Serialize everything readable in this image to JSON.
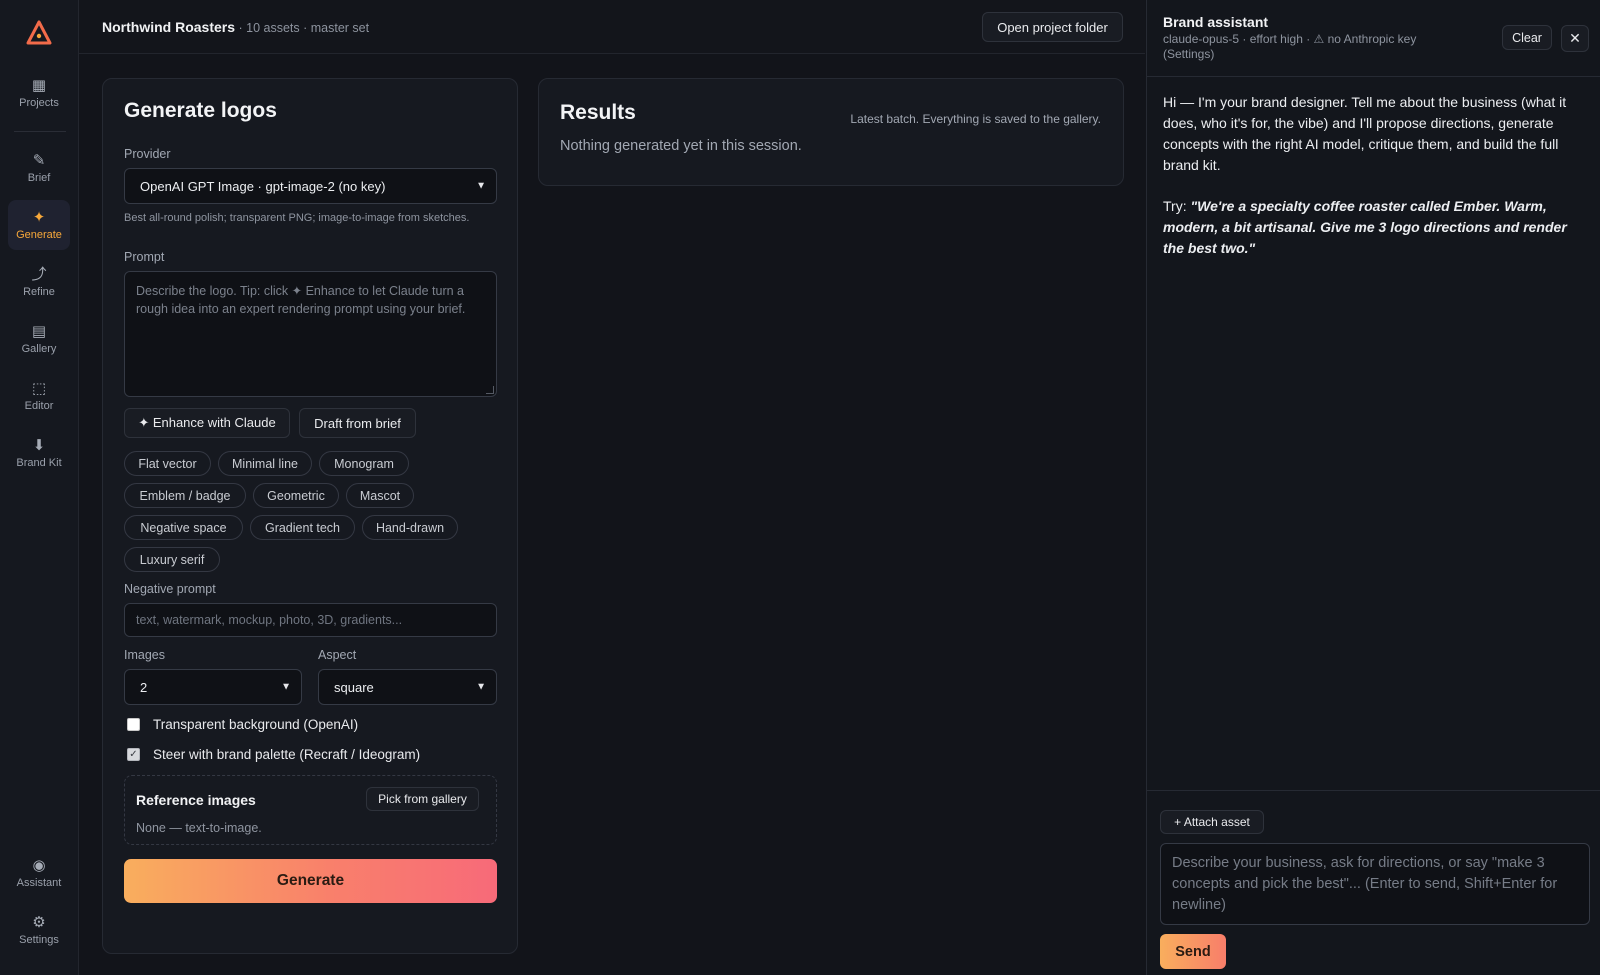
{
  "colors": {
    "accent": "#f7a83a",
    "bg": "#12141a",
    "panel": "#161920",
    "gradient_start": "#f9ae5d",
    "gradient_end": "#f76a79"
  },
  "rail": {
    "items": [
      {
        "icon": "grid-icon",
        "glyph": "▦",
        "label": "Projects"
      },
      {
        "icon": "pencil-icon",
        "glyph": "✎",
        "label": "Brief"
      },
      {
        "icon": "sparkle-icon",
        "glyph": "✦",
        "label": "Generate"
      },
      {
        "icon": "refine-arrow-icon",
        "glyph": "⤴",
        "label": "Refine"
      },
      {
        "icon": "gallery-icon",
        "glyph": "▤",
        "label": "Gallery"
      },
      {
        "icon": "editor-icon",
        "glyph": "⬚",
        "label": "Editor"
      },
      {
        "icon": "download-icon",
        "glyph": "⬇",
        "label": "Brand Kit"
      },
      {
        "icon": "assistant-icon",
        "glyph": "◉",
        "label": "Assistant"
      },
      {
        "icon": "gear-icon",
        "glyph": "⚙",
        "label": "Settings"
      }
    ],
    "active": "Generate"
  },
  "topbar": {
    "project_name": "Northwind Roasters",
    "meta": " · 10 assets · master set",
    "open_folder": "Open project folder"
  },
  "generate": {
    "title": "Generate logos",
    "provider_label": "Provider",
    "provider_value": "OpenAI GPT Image · gpt-image-2 (no key)",
    "provider_hint": "Best all-round polish; transparent PNG; image-to-image from sketches.",
    "prompt_label": "Prompt",
    "prompt_placeholder": "Describe the logo. Tip: click ✦ Enhance to let Claude turn a rough idea into an expert rendering prompt using your brief.",
    "enhance_button": "✦ Enhance with Claude",
    "draft_button": "Draft from brief",
    "styles": [
      "Flat vector",
      "Minimal line",
      "Monogram",
      "Emblem / badge",
      "Geometric",
      "Mascot",
      "Negative space",
      "Gradient tech",
      "Hand-drawn",
      "Luxury serif"
    ],
    "negative_label": "Negative prompt",
    "negative_placeholder": "text, watermark, mockup, photo, 3D, gradients...",
    "images_label": "Images",
    "images_value": "2",
    "aspect_label": "Aspect",
    "aspect_value": "square",
    "transparent_label": "Transparent background (OpenAI)",
    "transparent_checked": false,
    "palette_label": "Steer with brand palette (Recraft / Ideogram)",
    "palette_checked": true,
    "reference_title": "Reference images",
    "reference_pick": "Pick from gallery",
    "reference_status": "None — text-to-image.",
    "generate_button": "Generate"
  },
  "results": {
    "title": "Results",
    "note": "Latest batch. Everything is saved to the gallery.",
    "empty": "Nothing generated yet in this session."
  },
  "assistant": {
    "title": "Brand assistant",
    "subtitle": "claude-opus-5 · effort high · ⚠ no Anthropic key (Settings)",
    "clear": "Clear",
    "close": "✕",
    "message1": "Hi — I'm your brand designer. Tell me about the business (what it does, who it's for, the vibe) and I'll propose directions, generate concepts with the right AI model, critique them, and build the full brand kit.",
    "message2_prefix": "Try: ",
    "message2_example": "\"We're a specialty coffee roaster called Ember. Warm, modern, a bit artisanal. Give me 3 logo directions and render the best two.\"",
    "attach": "+ Attach asset",
    "input_placeholder": "Describe your business, ask for directions, or say \"make 3 concepts and pick the best\"... (Enter to send, Shift+Enter for newline)",
    "send": "Send"
  }
}
